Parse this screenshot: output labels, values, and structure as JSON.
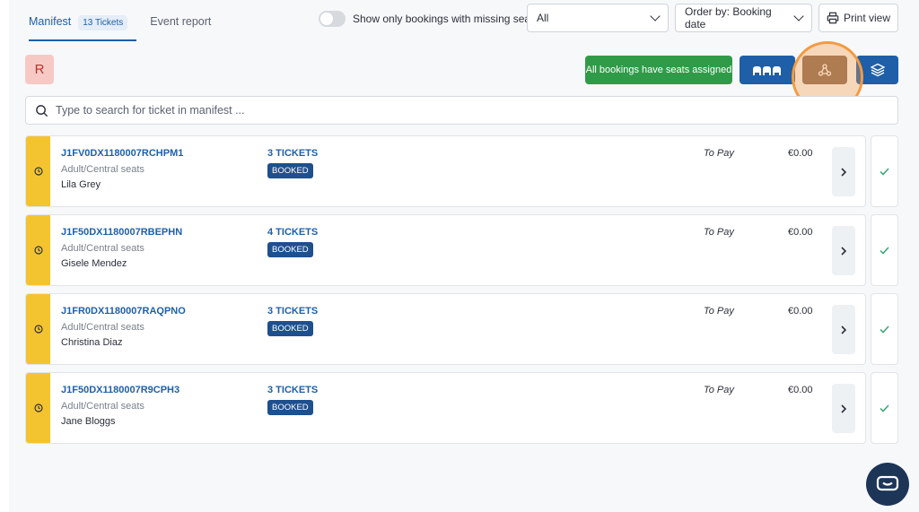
{
  "tabs": {
    "manifest_label": "Manifest",
    "manifest_count": "13 Tickets",
    "event_report_label": "Event report"
  },
  "filters": {
    "toggle_label": "Show only bookings with missing seats",
    "filter_value": "All",
    "order_value": "Order by: Booking date",
    "print_label": "Print view"
  },
  "toolbar": {
    "avatar_letter": "R",
    "status_text": "All bookings have seats assigned"
  },
  "search": {
    "placeholder": "Type to search for ticket in manifest ..."
  },
  "bookings": [
    {
      "ref": "J1FV0DX1180007RCHPM1",
      "type": "Adult/Central seats",
      "name": "Lila Grey",
      "tickets": "3 TICKETS",
      "status": "BOOKED",
      "pay_label": "To Pay",
      "amount": "€0.00"
    },
    {
      "ref": "J1F50DX1180007RBEPHN",
      "type": "Adult/Central seats",
      "name": "Gisele Mendez",
      "tickets": "4 TICKETS",
      "status": "BOOKED",
      "pay_label": "To Pay",
      "amount": "€0.00"
    },
    {
      "ref": "J1FR0DX1180007RAQPNO",
      "type": "Adult/Central seats",
      "name": "Christina Diaz",
      "tickets": "3 TICKETS",
      "status": "BOOKED",
      "pay_label": "To Pay",
      "amount": "€0.00"
    },
    {
      "ref": "J1F50DX1180007R9CPH3",
      "type": "Adult/Central seats",
      "name": "Jane Bloggs",
      "tickets": "3 TICKETS",
      "status": "BOOKED",
      "pay_label": "To Pay",
      "amount": "€0.00"
    }
  ],
  "colors": {
    "accent": "#1e5fa8",
    "success": "#2f9b48",
    "pending_stripe": "#f4c430",
    "highlight": "#f39a43"
  },
  "icons": [
    "search-icon",
    "chevron-down-icon",
    "printer-icon",
    "seats-icon",
    "network-icon",
    "layers-icon",
    "clock-icon",
    "chevron-right-icon",
    "check-icon",
    "chat-icon"
  ]
}
